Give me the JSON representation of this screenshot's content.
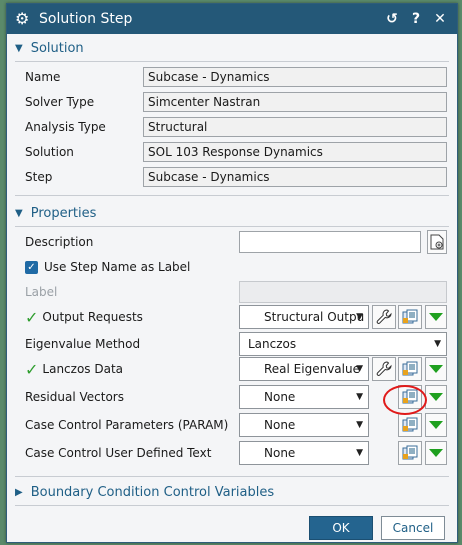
{
  "window": {
    "title": "Solution Step",
    "icon": "gear-icon"
  },
  "solution_section": {
    "title": "Solution",
    "rows": [
      {
        "label": "Name",
        "value": "Subcase - Dynamics"
      },
      {
        "label": "Solver Type",
        "value": "Simcenter Nastran"
      },
      {
        "label": "Analysis Type",
        "value": "Structural"
      },
      {
        "label": "Solution",
        "value": "SOL 103 Response Dynamics"
      },
      {
        "label": "Step",
        "value": "Subcase - Dynamics"
      }
    ]
  },
  "properties_section": {
    "title": "Properties",
    "description_label": "Description",
    "description_value": "",
    "use_step_name_label": "Use Step Name as Label",
    "use_step_name_checked": true,
    "label_label": "Label",
    "label_value": "",
    "output_requests": {
      "label": "Output Requests",
      "value": "Structural Outpu"
    },
    "eigenvalue_method": {
      "label": "Eigenvalue Method",
      "value": "Lanczos"
    },
    "lanczos_data": {
      "label": "Lanczos Data",
      "value": "Real Eigenvalue"
    },
    "residual_vectors": {
      "label": "Residual Vectors",
      "value": "None"
    },
    "case_control_param": {
      "label": "Case Control Parameters (PARAM)",
      "value": "None"
    },
    "case_control_udt": {
      "label": "Case Control User Defined Text",
      "value": "None"
    }
  },
  "boundary_section": {
    "title": "Boundary Condition Control Variables"
  },
  "buttons": {
    "ok": "OK",
    "cancel": "Cancel"
  },
  "colors": {
    "titlebar": "#245878",
    "accent": "#1f5f86",
    "check": "#2f9e2f",
    "highlight": "#e01a1a"
  }
}
